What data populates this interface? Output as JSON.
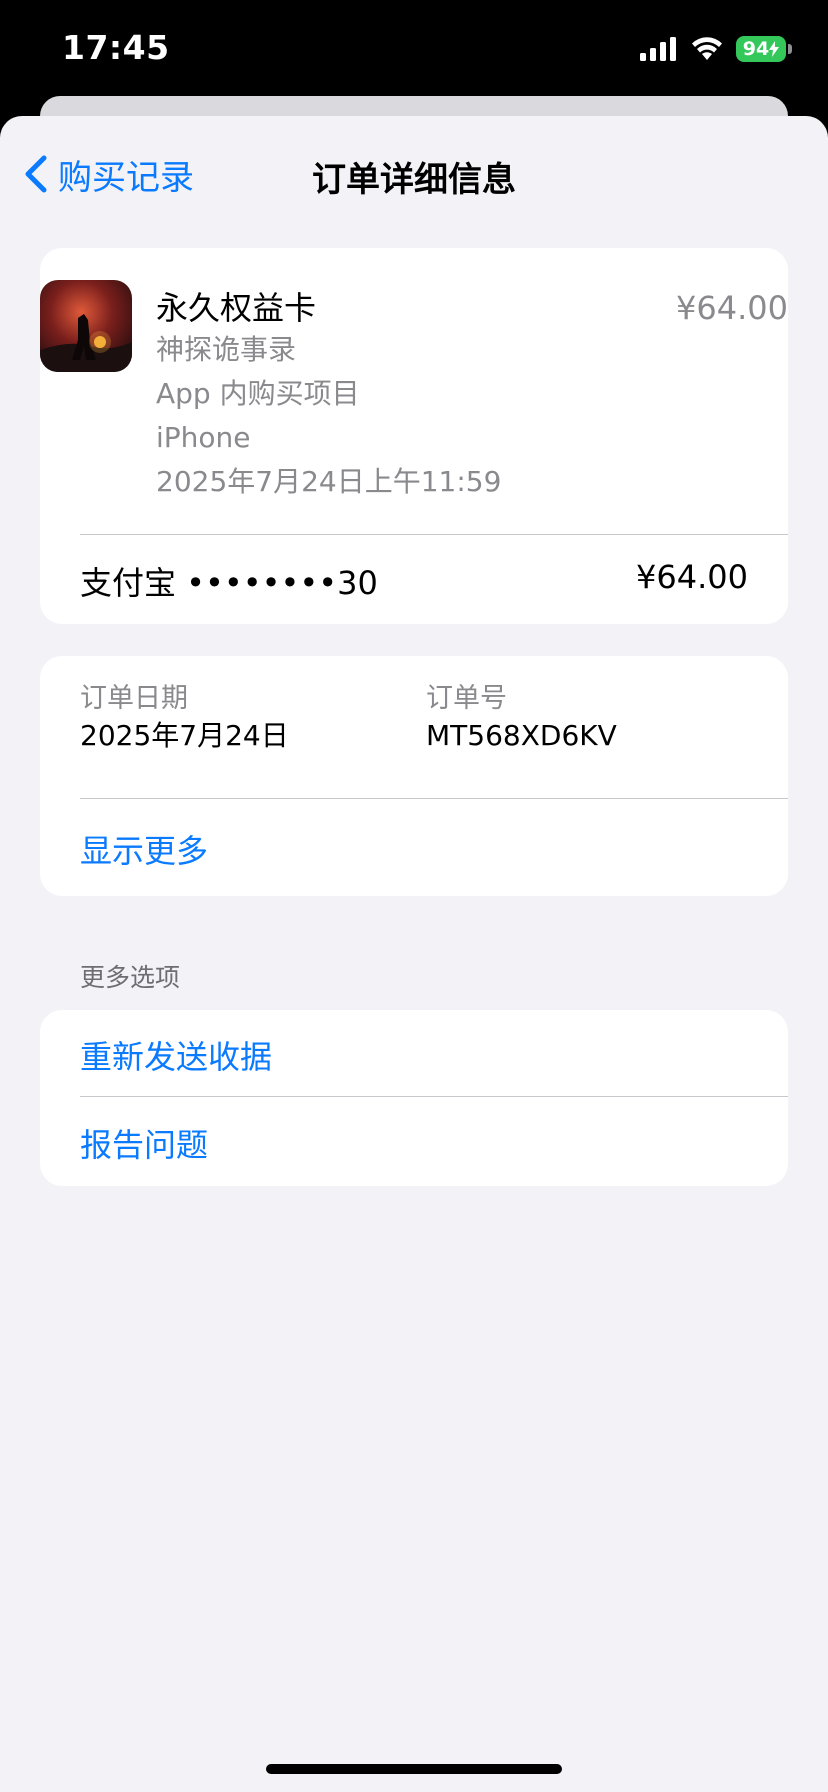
{
  "status": {
    "time": "17:45",
    "battery": "94"
  },
  "nav": {
    "back_label": "购买记录",
    "title": "订单详细信息"
  },
  "product": {
    "name": "永久权益卡",
    "app_name": "神探诡事录",
    "kind": "App 内购买项目",
    "device": "iPhone",
    "date_time": "2025年7月24日上午11:59",
    "price": "¥64.00"
  },
  "payment": {
    "method": "支付宝 ••••••••30",
    "amount": "¥64.00"
  },
  "order": {
    "date_label": "订单日期",
    "date_value": "2025年7月24日",
    "id_label": "订单号",
    "id_value": "MT568XD6KV",
    "show_more": "显示更多"
  },
  "more_options": {
    "header": "更多选项",
    "resend": "重新发送收据",
    "report": "报告问题"
  },
  "colors": {
    "accent": "#0a7aff",
    "battery": "#34c759",
    "background": "#f2f2f7"
  }
}
